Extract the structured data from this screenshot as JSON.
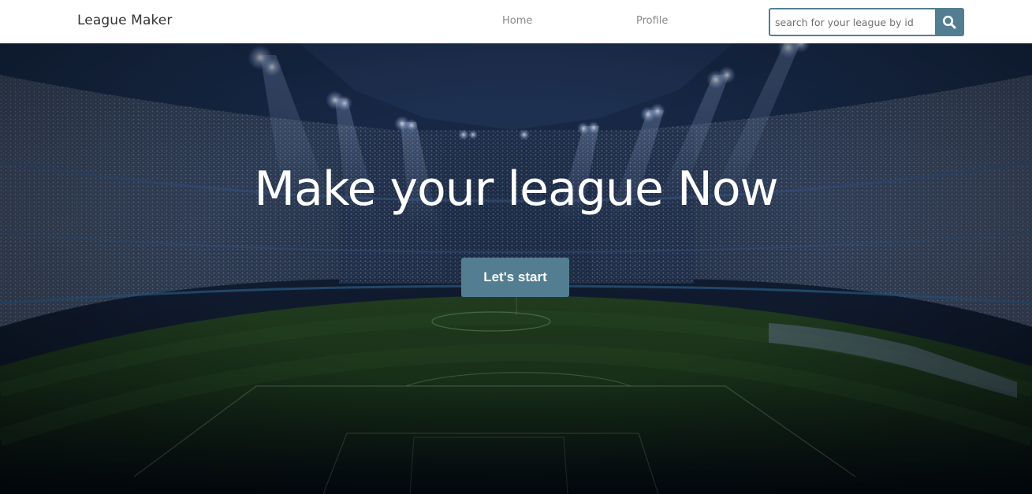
{
  "navbar": {
    "brand": "League Maker",
    "links": [
      {
        "label": "Home"
      },
      {
        "label": "Profile"
      }
    ],
    "search": {
      "placeholder": "search for your league by id",
      "value": "",
      "icon": "search-icon"
    }
  },
  "hero": {
    "title": "Make your league Now",
    "cta_label": "Let's start",
    "background": "stadium-photo"
  },
  "colors": {
    "accent": "#537e91",
    "navbar_bg": "#ffffff",
    "hero_text": "#ffffff"
  }
}
